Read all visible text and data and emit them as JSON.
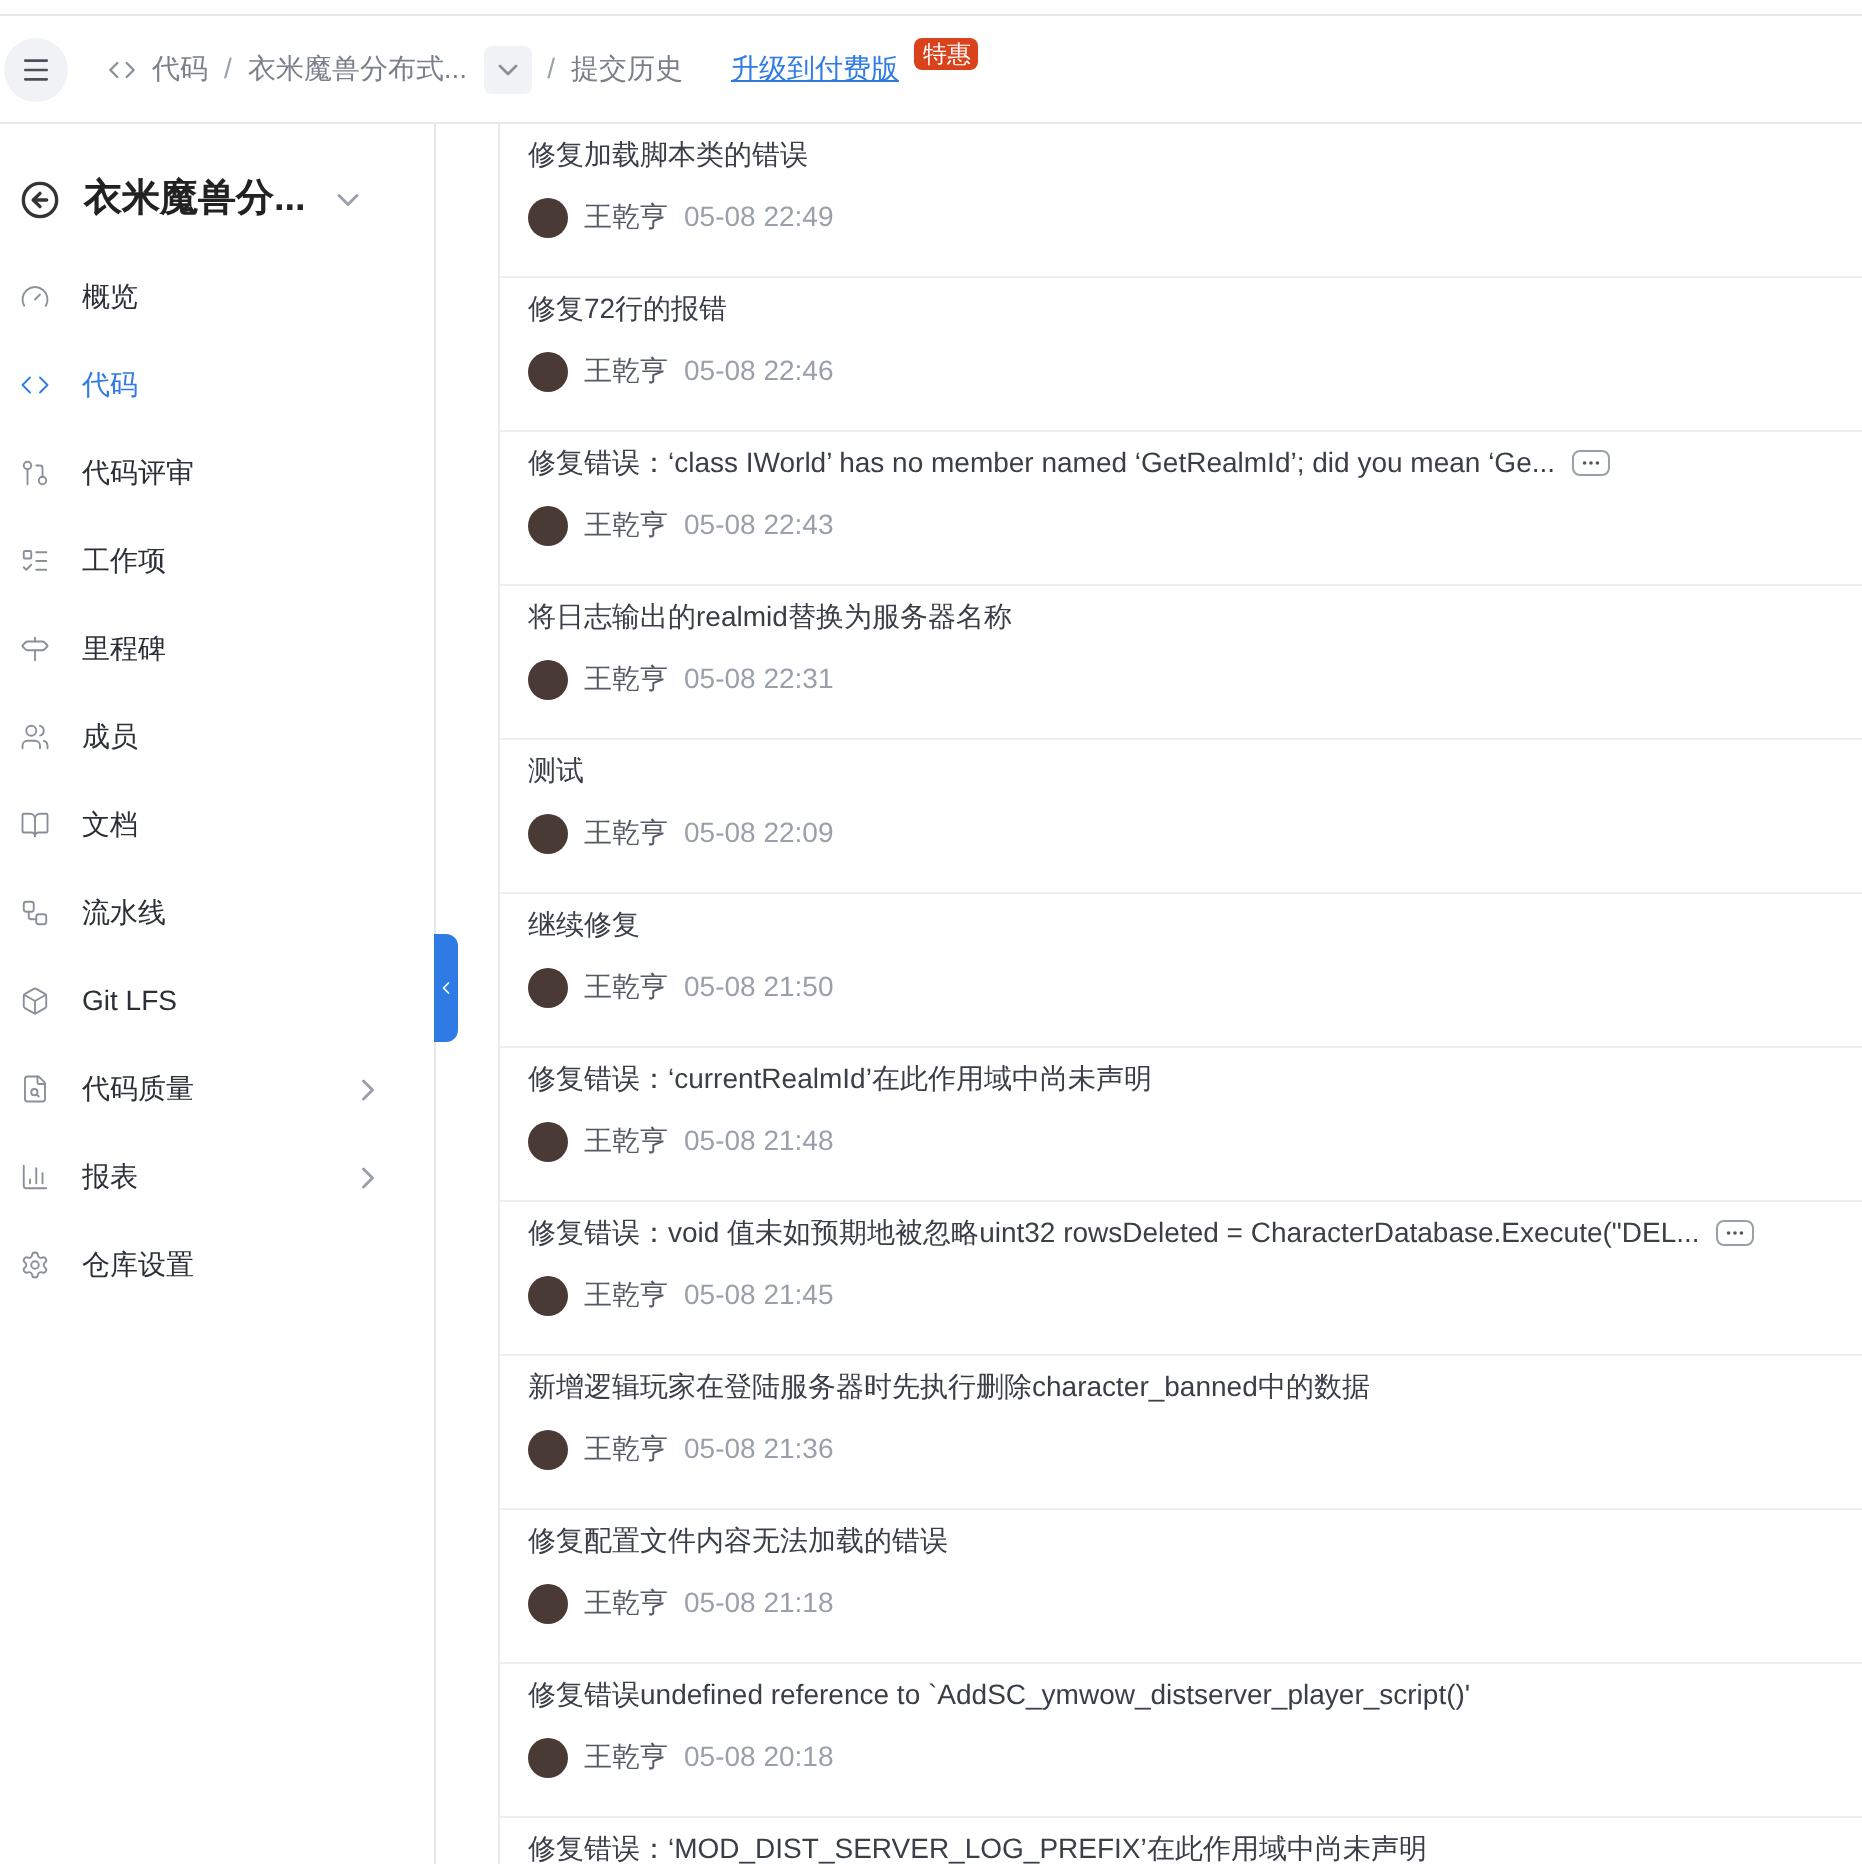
{
  "header": {
    "breadcrumbs": [
      {
        "label": "代码",
        "kind": "code"
      },
      {
        "separator": "/",
        "label": "衣米魔兽分布式...",
        "kind": "repo"
      },
      {
        "separator": "/",
        "label": "提交历史",
        "kind": "plain"
      }
    ],
    "upgrade_link": "升级到付费版",
    "upgrade_badge": "特惠"
  },
  "sidebar": {
    "title": "衣米魔兽分...",
    "items": [
      {
        "label": "概览",
        "selected": false,
        "expandable": false
      },
      {
        "label": "代码",
        "selected": true,
        "expandable": false
      },
      {
        "label": "代码评审",
        "selected": false,
        "expandable": false
      },
      {
        "label": "工作项",
        "selected": false,
        "expandable": false
      },
      {
        "label": "里程碑",
        "selected": false,
        "expandable": false
      },
      {
        "label": "成员",
        "selected": false,
        "expandable": false
      },
      {
        "label": "文档",
        "selected": false,
        "expandable": false
      },
      {
        "label": "流水线",
        "selected": false,
        "expandable": false
      },
      {
        "label": "Git LFS",
        "selected": false,
        "expandable": false
      },
      {
        "label": "代码质量",
        "selected": false,
        "expandable": true
      },
      {
        "label": "报表",
        "selected": false,
        "expandable": true
      },
      {
        "label": "仓库设置",
        "selected": false,
        "expandable": false
      }
    ]
  },
  "commits": [
    {
      "title": "修复加载脚本类的错误",
      "truncated": false,
      "author": "王乾亨",
      "time": "05-08 22:49"
    },
    {
      "title": "修复72行的报错",
      "truncated": false,
      "author": "王乾亨",
      "time": "05-08 22:46"
    },
    {
      "title": "修复错误：‘class IWorld’ has no member named ‘GetRealmId’; did you mean ‘Ge...",
      "truncated": true,
      "author": "王乾亨",
      "time": "05-08 22:43"
    },
    {
      "title": "将日志输出的realmid替换为服务器名称",
      "truncated": false,
      "author": "王乾亨",
      "time": "05-08 22:31"
    },
    {
      "title": "测试",
      "truncated": false,
      "author": "王乾亨",
      "time": "05-08 22:09"
    },
    {
      "title": "继续修复",
      "truncated": false,
      "author": "王乾亨",
      "time": "05-08 21:50"
    },
    {
      "title": "修复错误：‘currentRealmId’在此作用域中尚未声明",
      "truncated": false,
      "author": "王乾亨",
      "time": "05-08 21:48"
    },
    {
      "title": "修复错误：void 值未如预期地被忽略uint32 rowsDeleted = CharacterDatabase.Execute(\"DEL...",
      "truncated": true,
      "author": "王乾亨",
      "time": "05-08 21:45"
    },
    {
      "title": "新增逻辑玩家在登陆服务器时先执行删除character_banned中的数据",
      "truncated": false,
      "author": "王乾亨",
      "time": "05-08 21:36"
    },
    {
      "title": "修复配置文件内容无法加载的错误",
      "truncated": false,
      "author": "王乾亨",
      "time": "05-08 21:18"
    },
    {
      "title": "修复错误undefined reference to `AddSC_ymwow_distserver_player_script()'",
      "truncated": false,
      "author": "王乾亨",
      "time": "05-08 20:18"
    },
    {
      "title": "修复错误：‘MOD_DIST_SERVER_LOG_PREFIX’在此作用域中尚未声明",
      "truncated": false
    }
  ]
}
